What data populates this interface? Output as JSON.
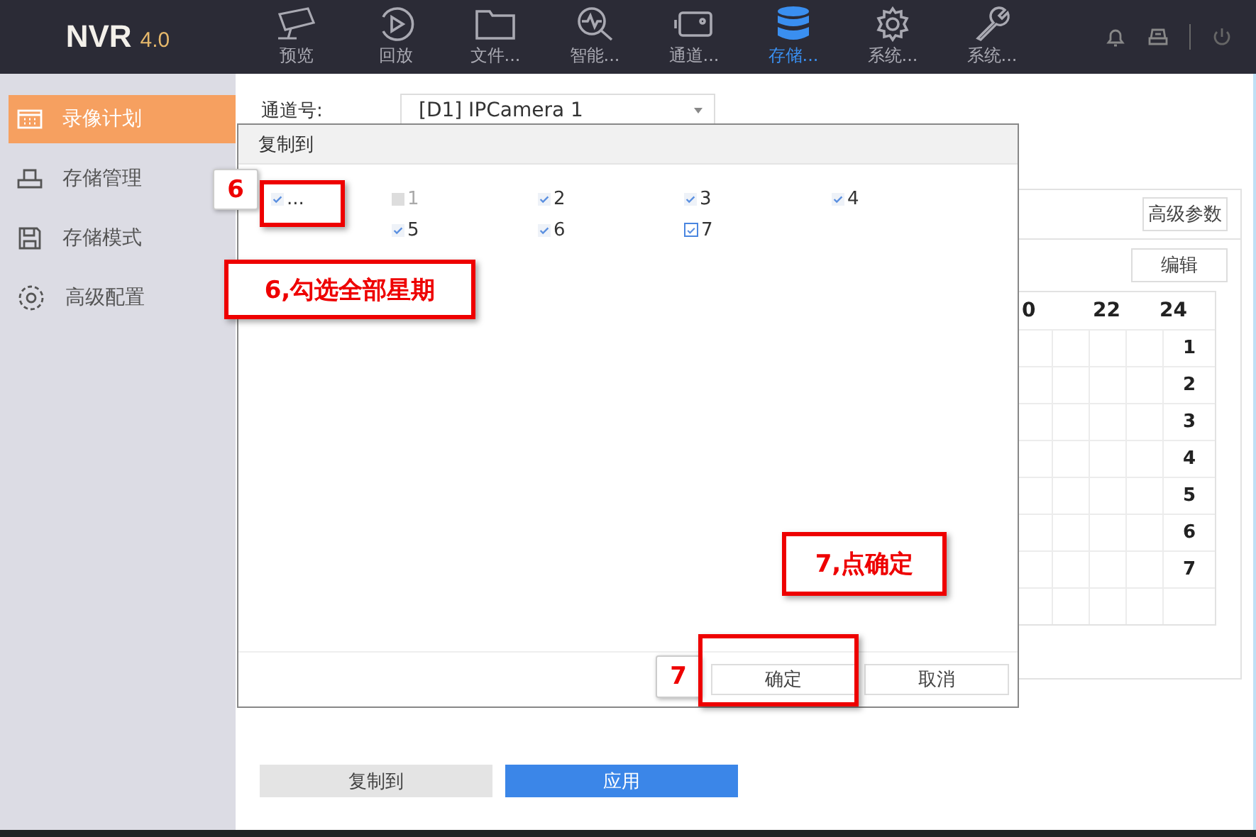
{
  "logo": {
    "name": "NVR",
    "version": "4.0"
  },
  "nav": [
    {
      "label": "预览",
      "selected": false
    },
    {
      "label": "回放",
      "selected": false
    },
    {
      "label": "文件...",
      "selected": false
    },
    {
      "label": "智能...",
      "selected": false
    },
    {
      "label": "通道...",
      "selected": false
    },
    {
      "label": "存储...",
      "selected": true
    },
    {
      "label": "系统...",
      "selected": false
    },
    {
      "label": "系统...",
      "selected": false
    }
  ],
  "sidebar": {
    "items": [
      {
        "label": "录像计划",
        "selected": true
      },
      {
        "label": "存储管理",
        "selected": false
      },
      {
        "label": "存储模式",
        "selected": false
      },
      {
        "label": "高级配置",
        "selected": false
      }
    ]
  },
  "channel": {
    "label": "通道号:",
    "value": "[D1] IPCamera 1"
  },
  "schedule": {
    "advanced_button": "高级参数",
    "edit_button": "编辑",
    "hours": [
      "0",
      "22",
      "24"
    ],
    "days": [
      "1",
      "2",
      "3",
      "4",
      "5",
      "6",
      "7"
    ]
  },
  "bottom_buttons": [
    {
      "label": "复制到",
      "kind": "secondary"
    },
    {
      "label": "应用",
      "kind": "primary"
    }
  ],
  "dialog": {
    "title": "复制到",
    "options": [
      {
        "label": "...",
        "checked": true,
        "disabled": false,
        "focused": false
      },
      {
        "label": "1",
        "checked": false,
        "disabled": true,
        "focused": false
      },
      {
        "label": "2",
        "checked": true,
        "disabled": false,
        "focused": false
      },
      {
        "label": "3",
        "checked": true,
        "disabled": false,
        "focused": false
      },
      {
        "label": "4",
        "checked": true,
        "disabled": false,
        "focused": false
      },
      {
        "label": "5",
        "checked": true,
        "disabled": false,
        "focused": false
      },
      {
        "label": "6",
        "checked": true,
        "disabled": false,
        "focused": false
      },
      {
        "label": "7",
        "checked": true,
        "disabled": false,
        "focused": true
      }
    ],
    "ok_button": "确定",
    "cancel_button": "取消"
  },
  "annotations": [
    {
      "kind": "badge",
      "text": "6"
    },
    {
      "kind": "outline"
    },
    {
      "kind": "callout",
      "text": "6,勾选全部星期"
    },
    {
      "kind": "callout",
      "text": "7,点确定"
    },
    {
      "kind": "badge",
      "text": "7"
    },
    {
      "kind": "outline"
    }
  ]
}
